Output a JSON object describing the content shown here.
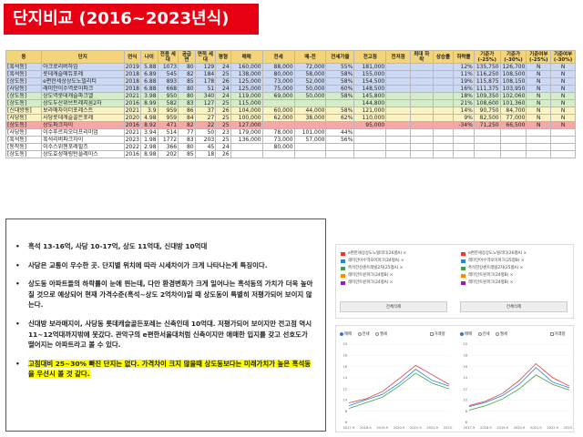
{
  "title": "단지비교 (2016~2023년식)",
  "table": {
    "headers": [
      "동",
      "단지",
      "연식",
      "나이",
      "전용 세대",
      "공급 면",
      "면적 세대",
      "평형",
      "매매",
      "전세",
      "매-전",
      "전세가율",
      "전고점",
      "전저점",
      "최대 하락",
      "상승률",
      "하락률",
      "기준가 (-25%)",
      "기준가 (-30%)",
      "기준여부 (-25%)",
      "기준여부 (-30%)"
    ],
    "rows": [
      {
        "style": "r-blue",
        "cells": [
          "[흑석동]",
          "아크로리버하임",
          "2019",
          "5.88",
          "1073",
          "80",
          "129",
          "24",
          "160,000",
          "88,000",
          "72,000",
          "55%",
          "181,000",
          "",
          "",
          "",
          "12%",
          "135,750",
          "126,700",
          "N",
          "N"
        ]
      },
      {
        "style": "r-blue",
        "cells": [
          "[흑석동]",
          "롯데캐슬에듀포레",
          "2018",
          "6.89",
          "545",
          "82",
          "184",
          "25",
          "138,000",
          "80,000",
          "58,000",
          "58%",
          "155,000",
          "",
          "",
          "",
          "11%",
          "116,250",
          "108,500",
          "N",
          "N"
        ]
      },
      {
        "style": "r-blue",
        "cells": [
          "[상도동]",
          "e편한세상상도노빌리티",
          "2018",
          "6.88",
          "893",
          "85",
          "178",
          "26",
          "125,000",
          "73,000",
          "52,000",
          "58%",
          "154,500",
          "",
          "",
          "",
          "19%",
          "115,875",
          "108,150",
          "N",
          "N"
        ]
      },
      {
        "style": "r-blue",
        "cells": [
          "[사당동]",
          "래미안이수역로이파크",
          "2018",
          "6.88",
          "668",
          "80",
          "51",
          "24",
          "125,000",
          "75,000",
          "50,000",
          "60%",
          "148,500",
          "",
          "",
          "",
          "16%",
          "111,375",
          "103,950",
          "N",
          "N"
        ]
      },
      {
        "style": "r-green",
        "cells": [
          "[상도동]",
          "상도역롯데캐슬파크엘",
          "2021",
          "3.98",
          "950",
          "80",
          "340",
          "24",
          "119,000",
          "69,000",
          "50,000",
          "58%",
          "145,800",
          "",
          "",
          "",
          "18%",
          "109,350",
          "102,060",
          "N",
          "N"
        ]
      },
      {
        "style": "r-green",
        "cells": [
          "[상도동]",
          "상도두산위브트레지움2차",
          "2016",
          "8.99",
          "582",
          "83",
          "127",
          "25",
          "115,000",
          "",
          "",
          "",
          "144,800",
          "",
          "",
          "",
          "21%",
          "108,600",
          "101,360",
          "N",
          "N"
        ]
      },
      {
        "style": "r-yellow",
        "cells": [
          "[신대방동]",
          "보라매자이더포레스트",
          "2021",
          "3.9",
          "959",
          "86",
          "37",
          "26",
          "104,000",
          "60,000",
          "44,000",
          "58%",
          "121,000",
          "",
          "",
          "",
          "14%",
          "90,750",
          "84,700",
          "N",
          "N"
        ]
      },
      {
        "style": "r-yellow",
        "cells": [
          "[사당동]",
          "사당롯데캐슬골든포레",
          "2020",
          "4.98",
          "959",
          "84",
          "27",
          "25",
          "100,000",
          "62,000",
          "38,000",
          "62%",
          "110,000",
          "",
          "",
          "",
          "9%",
          "82,500",
          "77,000",
          "N",
          "N"
        ]
      },
      {
        "style": "r-red",
        "cells": [
          "[상도동]",
          "상도파크자이",
          "2016",
          "8.92",
          "471",
          "82",
          "22",
          "25",
          "127,000",
          "",
          "",
          "",
          "95,000",
          "",
          "",
          "",
          "-34%",
          "71,250",
          "66,500",
          "N",
          "N"
        ]
      },
      {
        "style": "r-white",
        "cells": [
          "[사당동]",
          "이수푸르지오더프리미엄",
          "2021",
          "3.94",
          "514",
          "77",
          "50",
          "23",
          "179,000",
          "78,000",
          "101,000",
          "44%",
          "",
          "",
          "",
          "",
          "",
          "",
          "",
          "",
          ""
        ]
      },
      {
        "style": "r-white",
        "cells": [
          "[흑석동]",
          "흑석리버파크자이",
          "2023",
          "1.98",
          "1772",
          "83",
          "203",
          "25",
          "136,000",
          "73,000",
          "57,000",
          "56%",
          "",
          "",
          "",
          "",
          "",
          "",
          "",
          "",
          ""
        ]
      },
      {
        "style": "r-white",
        "cells": [
          "[동작동]",
          "이수스위첸포레힐즈",
          "2022",
          "2.98",
          "366",
          "80",
          "45",
          "24",
          "",
          "80,000",
          "",
          "",
          "",
          "",
          "",
          "",
          "",
          "",
          "",
          "",
          ""
        ]
      },
      {
        "style": "r-white",
        "cells": [
          "[상도동]",
          "상도효성해링턴플레이스",
          "2016",
          "8.98",
          "202",
          "85",
          "18",
          "26",
          "",
          "",
          "",
          "",
          "",
          "",
          "",
          "",
          "",
          "",
          "",
          "",
          ""
        ]
      }
    ]
  },
  "notes": [
    "흑석 13-16억, 사당 10-17억, 상도 11억대, 신대방 10억대",
    "사당은 교통이 우수한 곳. 단지별 위치에 따라 시세차이가 크게 나타나는게 특징이다.",
    "상도동 아파트들의 하락률이 눈에 띈는데, 다만 환경변화가 크게 일어나는 흑석동의 가치가 더욱 높아질 것으로 예상되어 현재 가격수준(흑석~상도 2억차이)일 때 상도동이 특별히 저평가되어 보이지 않는다.",
    "신대방 보라매지이, 사당동 롯데캐슬골든포레는 신축인데 10억대. 저평가되어 보이지만 전고점 역시 11~12억대까지밖에 못갔다. 관악구의 e편한서울대처럼 신축이지만 애매한 입지를 갖고 선호도가 떨어지는 아파트라고 볼 수 있다.",
    "고점대비 25~30% 빠진 단지는 없다. 가격차이 크지 않을때 상도동보다는 미래가치가 높은 흑석동을 우선시 볼 것 같다."
  ],
  "legend": {
    "left": [
      {
        "label": "e편한세상상도노빌리티(26평A)",
        "color": "#e53935"
      },
      {
        "label": "래미안이수역로이파크(24평A)",
        "color": "#1e88e5"
      },
      {
        "label": "흑석한강센트레빌2차(25평A)",
        "color": "#43a047"
      },
      {
        "label": "래미안트윈파크(24평B)",
        "color": "#fb8c00"
      },
      {
        "label": "래미안트윈파크(24평A)",
        "color": "#8e24aa"
      }
    ],
    "right": [
      {
        "label": "e편한세상상도노빌리티(26평A)",
        "color": "#e53935"
      },
      {
        "label": "래미안이수역로이파크(25평B)",
        "color": "#1e88e5"
      },
      {
        "label": "흑석한강센트레빌2차(25평A)",
        "color": "#43a047"
      },
      {
        "label": "래미안트윈파크(24평B)",
        "color": "#fb8c00"
      },
      {
        "label": "래미안트윈파크(24평B)",
        "color": "#8e24aa"
      }
    ],
    "apply_left": "전체삭제",
    "apply_right": "전체삭제"
  },
  "chart_controls": {
    "left": [
      "매매",
      "전세",
      "월세"
    ],
    "left_check": "거래량",
    "right": [
      "매매",
      "전세",
      "월세"
    ],
    "right_check": "거래량"
  },
  "chart_data": [
    {
      "type": "line",
      "x": [
        "2017.9",
        "2018.9",
        "2019.9",
        "2020.9",
        "2021.9",
        "2022.9",
        "2023.9"
      ],
      "y_ticks": [
        "20",
        "18",
        "16",
        "14",
        "12",
        "10",
        "8",
        "6"
      ],
      "ylim": [
        6,
        20
      ],
      "series": [
        {
          "name": "e편한세상상도노빌리티(26평A)",
          "color": "#e53935",
          "values": [
            9.5,
            10.2,
            11.5,
            13.8,
            16.2,
            14.5,
            12.8
          ]
        },
        {
          "name": "래미안이수역로이파크(24평A)",
          "color": "#1e88e5",
          "values": [
            9.0,
            10.0,
            11.0,
            13.0,
            15.5,
            13.5,
            12.5
          ]
        },
        {
          "name": "흑석한강센트레빌2차(25평A)",
          "color": "#43a047",
          "values": [
            8.5,
            9.5,
            10.5,
            12.5,
            14.8,
            13.0,
            12.0
          ]
        }
      ]
    },
    {
      "type": "line",
      "x": [
        "2017.9",
        "2018.9",
        "2019.9",
        "2020.9",
        "2021.9",
        "2022.9",
        "2023.9"
      ],
      "y_ticks": [
        "20",
        "18",
        "16",
        "14",
        "12",
        "10",
        "8",
        "6"
      ],
      "ylim": [
        6,
        20
      ],
      "series": [
        {
          "name": "e편한세상상도노빌리티(26평A)",
          "color": "#e53935",
          "values": [
            9.0,
            9.8,
            11.2,
            13.5,
            16.5,
            14.0,
            12.5
          ]
        },
        {
          "name": "래미안이수역로이파크(25평B)",
          "color": "#1e88e5",
          "values": [
            8.8,
            9.6,
            10.8,
            12.8,
            15.8,
            13.2,
            12.2
          ]
        },
        {
          "name": "흑석한강센트레빌2차(25평A)",
          "color": "#43a047",
          "values": [
            8.2,
            9.0,
            10.2,
            12.0,
            14.5,
            12.8,
            11.8
          ]
        }
      ]
    }
  ]
}
